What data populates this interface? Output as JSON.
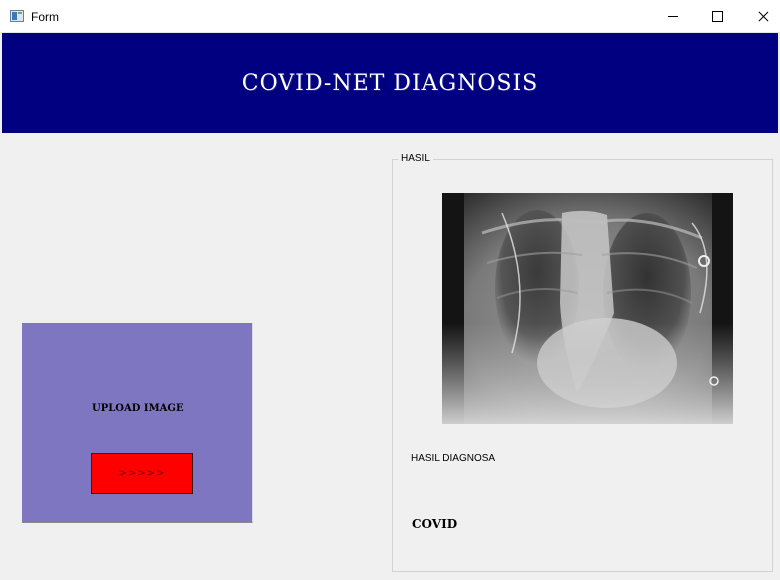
{
  "window": {
    "title": "Form",
    "icon": "app-window-icon",
    "controls": [
      "minimize-icon",
      "maximize-icon",
      "close-icon"
    ]
  },
  "banner": {
    "title": "COVID-NET DIAGNOSIS",
    "background": "#000080"
  },
  "upload": {
    "label": "UPLOAD IMAGE",
    "button_label": ">>>>>",
    "panel_color": "#7f76c2",
    "button_color": "#ff0000"
  },
  "result": {
    "group_title": "HASIL",
    "image": "chest-xray-image",
    "diagnosis_label": "HASIL DIAGNOSA",
    "diagnosis_value": "COVID"
  }
}
